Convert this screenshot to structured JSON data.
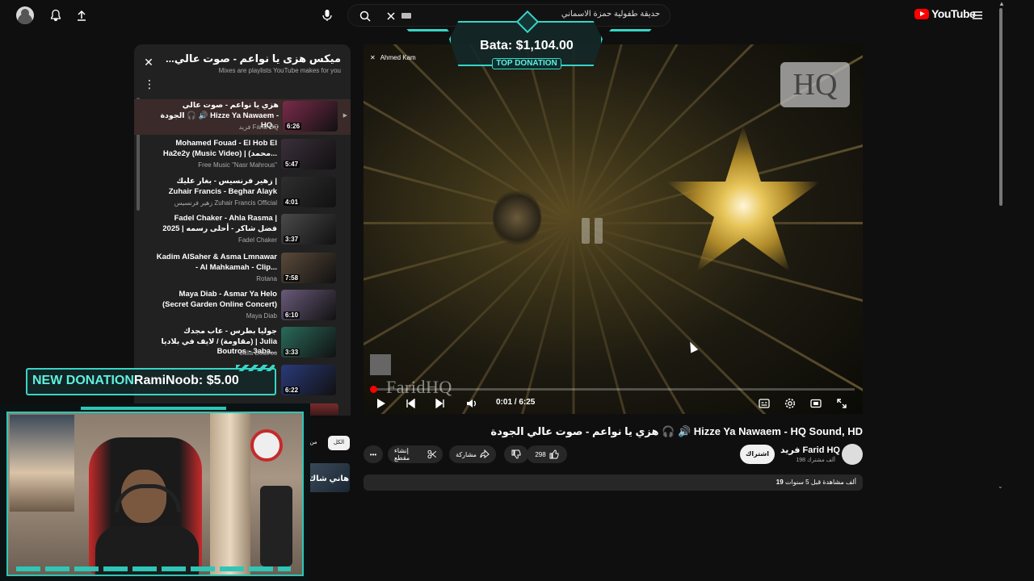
{
  "topbar": {
    "search_value": "حديقة طفولية حمزة الاسماني",
    "brand": "YouTube"
  },
  "playlist": {
    "title": "ميكس هزى يا نواعم - صوت عالي...",
    "subtitle": "Mixes are playlists YouTube makes for you",
    "items": [
      {
        "title": "هزي يا نواعم - صوت عالي الجودة 🎧 🔊 Hizze Ya Nawaem - HQ...",
        "channel": "فريد Farid HQ",
        "duration": "6:26",
        "thumb": "#7a2b4a"
      },
      {
        "title": "Mohamed Fouad - El Hob El Ha2e2y (Music Video) | (محمد...",
        "channel": "Free Music \"Nasr Mahrous\"",
        "duration": "5:47",
        "thumb": "#3b2f3a"
      },
      {
        "title": "زهير فرنسيس - بغار عليك | Zuhair Francis - Beghar Alayk",
        "channel": "زهير فرنسيس Zuhair Francis Official",
        "duration": "4:01",
        "thumb": "#2e2e2e"
      },
      {
        "title": "Fadel Chaker - Ahla Rasma | فضل شاكر - أحلى رسمه | 2025",
        "channel": "Fadel Chaker",
        "duration": "3:37",
        "thumb": "#4a4a4a"
      },
      {
        "title": "Kadim AlSaher & Asma Lmnawar - Al Mahkamah - Clip...",
        "channel": "Rotana",
        "duration": "7:58",
        "thumb": "#5a4a3a"
      },
      {
        "title": "Maya Diab - Asmar Ya Helo (Secret Garden Online Concert)",
        "channel": "Maya Diab",
        "duration": "6:10",
        "thumb": "#6a5a7a"
      },
      {
        "title": "جوليا بطرس - عاب مجدك (مقاومة) / لايف في بلاديا | Julia Boutros - 3aba...",
        "channel": "Julia Boutros",
        "duration": "3:33",
        "thumb": "#2a6a5a"
      },
      {
        "title": "",
        "channel": "",
        "duration": "6:22",
        "thumb": "#2a3a7a"
      }
    ]
  },
  "video": {
    "title": "هزي يا نواعم - صوت عالي الجودة 🎧 🔊 Hizze Ya Nawaem - HQ Sound, HD",
    "hq_badge": "HQ",
    "watermark": "FaridHQ",
    "time": "0:01 / 6:25",
    "toast_name": "Ahmed Kam",
    "progress": 0.003
  },
  "channel": {
    "name": "فريد Farid HQ",
    "subs": "198 ألف مشترك",
    "subscribe": "اشتراك"
  },
  "actions": {
    "likes": "298",
    "share": "مشاركة",
    "clip": "إنشاء مقطع"
  },
  "description": {
    "meta_bold": "19",
    "meta": "ألف مشاهدة  قبل 5 سنوات"
  },
  "chips": {
    "all": "الكل",
    "from": "من"
  },
  "side_thumb_text": "هاني شاك",
  "overlays": {
    "top_donation_amount": "Bata: $1,104.00",
    "top_donation_label": "TOP DONATION",
    "new_donation_label": "NEW DONATION",
    "new_donation_text": "RamiNoob: $5.00"
  },
  "colors": {
    "accent": "#36d6c6",
    "brand_red": "#ff0000",
    "bg": "#0f0f0f"
  }
}
